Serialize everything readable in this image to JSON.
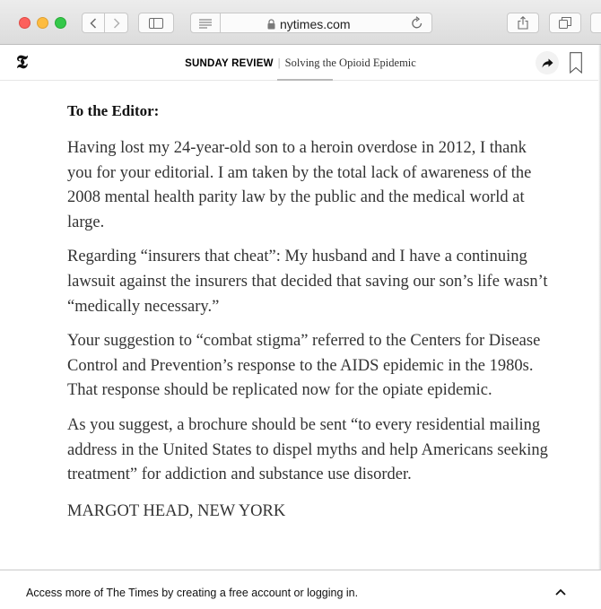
{
  "browser": {
    "url": "nytimes.com"
  },
  "header": {
    "logo": "𝕿",
    "section": "SUNDAY REVIEW",
    "headline": "Solving the Opioid Epidemic"
  },
  "article": {
    "greeting": "To the Editor:",
    "paragraphs": [
      "Having lost my 24-year-old son to a heroin overdose in 2012, I thank you for your editorial. I am taken by the total lack of awareness of the 2008 mental health parity law by the public and the medical world at large.",
      "Regarding “insurers that cheat”: My husband and I have a continuing lawsuit against the insurers that decided that saving our son’s life wasn’t “medically necessary.”",
      "Your suggestion to “combat stigma” referred to the Centers for Disease Control and Prevention’s response to the AIDS epidemic in the 1980s. That response should be replicated now for the opiate epidemic.",
      "As you suggest, a brochure should be sent “to every residential mailing address in the United States to dispel myths and help Americans seeking treatment” for addiction and substance use disorder."
    ],
    "signature": "MARGOT HEAD, NEW YORK"
  },
  "footer": {
    "text": "Access more of The Times by creating a free account or logging in."
  }
}
